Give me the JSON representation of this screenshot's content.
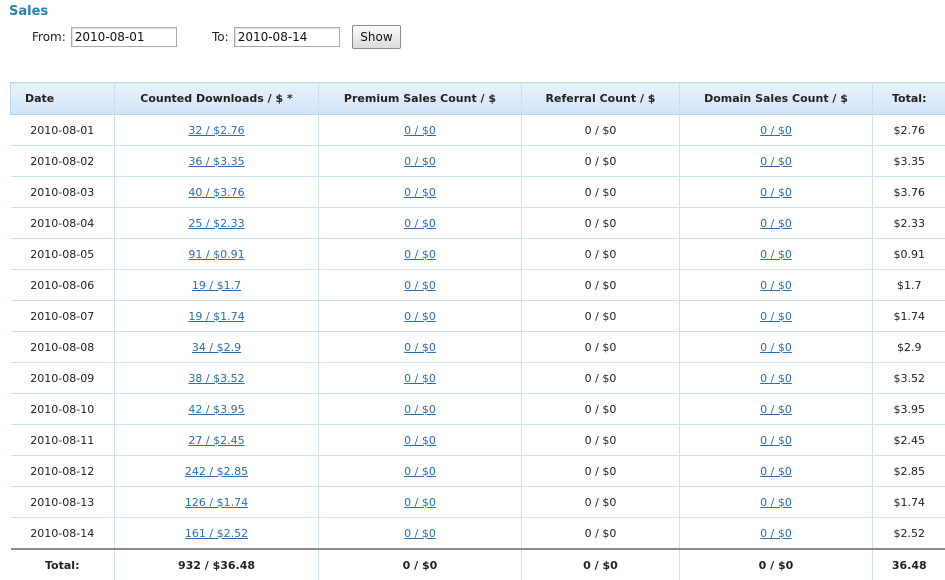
{
  "page": {
    "title": "Sales"
  },
  "filter": {
    "from_label": "From:",
    "from_value": "2010-08-01",
    "to_label": "To:",
    "to_value": "2010-08-14",
    "show_label": "Show"
  },
  "table": {
    "headers": [
      "Date",
      "Counted Downloads / $ *",
      "Premium Sales Count / $",
      "Referral Count / $",
      "Domain Sales Count / $",
      "Total:"
    ],
    "rows": [
      {
        "date": "2010-08-01",
        "downloads": "32 / $2.76",
        "premium": "0 / $0",
        "referral": "0 / $0",
        "domain": "0 / $0",
        "total": "$2.76"
      },
      {
        "date": "2010-08-02",
        "downloads": "36 / $3.35",
        "premium": "0 / $0",
        "referral": "0 / $0",
        "domain": "0 / $0",
        "total": "$3.35"
      },
      {
        "date": "2010-08-03",
        "downloads": "40 / $3.76",
        "premium": "0 / $0",
        "referral": "0 / $0",
        "domain": "0 / $0",
        "total": "$3.76"
      },
      {
        "date": "2010-08-04",
        "downloads": "25 / $2.33",
        "premium": "0 / $0",
        "referral": "0 / $0",
        "domain": "0 / $0",
        "total": "$2.33"
      },
      {
        "date": "2010-08-05",
        "downloads": "91 / $0.91",
        "premium": "0 / $0",
        "referral": "0 / $0",
        "domain": "0 / $0",
        "total": "$0.91"
      },
      {
        "date": "2010-08-06",
        "downloads": "19 / $1.7",
        "premium": "0 / $0",
        "referral": "0 / $0",
        "domain": "0 / $0",
        "total": "$1.7"
      },
      {
        "date": "2010-08-07",
        "downloads": "19 / $1.74",
        "premium": "0 / $0",
        "referral": "0 / $0",
        "domain": "0 / $0",
        "total": "$1.74"
      },
      {
        "date": "2010-08-08",
        "downloads": "34 / $2.9",
        "premium": "0 / $0",
        "referral": "0 / $0",
        "domain": "0 / $0",
        "total": "$2.9"
      },
      {
        "date": "2010-08-09",
        "downloads": "38 / $3.52",
        "premium": "0 / $0",
        "referral": "0 / $0",
        "domain": "0 / $0",
        "total": "$3.52"
      },
      {
        "date": "2010-08-10",
        "downloads": "42 / $3.95",
        "premium": "0 / $0",
        "referral": "0 / $0",
        "domain": "0 / $0",
        "total": "$3.95"
      },
      {
        "date": "2010-08-11",
        "downloads": "27 / $2.45",
        "premium": "0 / $0",
        "referral": "0 / $0",
        "domain": "0 / $0",
        "total": "$2.45"
      },
      {
        "date": "2010-08-12",
        "downloads": "242 / $2.85",
        "premium": "0 / $0",
        "referral": "0 / $0",
        "domain": "0 / $0",
        "total": "$2.85"
      },
      {
        "date": "2010-08-13",
        "downloads": "126 / $1.74",
        "premium": "0 / $0",
        "referral": "0 / $0",
        "domain": "0 / $0",
        "total": "$1.74"
      },
      {
        "date": "2010-08-14",
        "downloads": "161 / $2.52",
        "premium": "0 / $0",
        "referral": "0 / $0",
        "domain": "0 / $0",
        "total": "$2.52"
      }
    ],
    "totals": {
      "label": "Total:",
      "downloads": "932 / $36.48",
      "premium": "0 / $0",
      "referral": "0 / $0",
      "domain": "0 / $0",
      "total": "36.48"
    }
  }
}
